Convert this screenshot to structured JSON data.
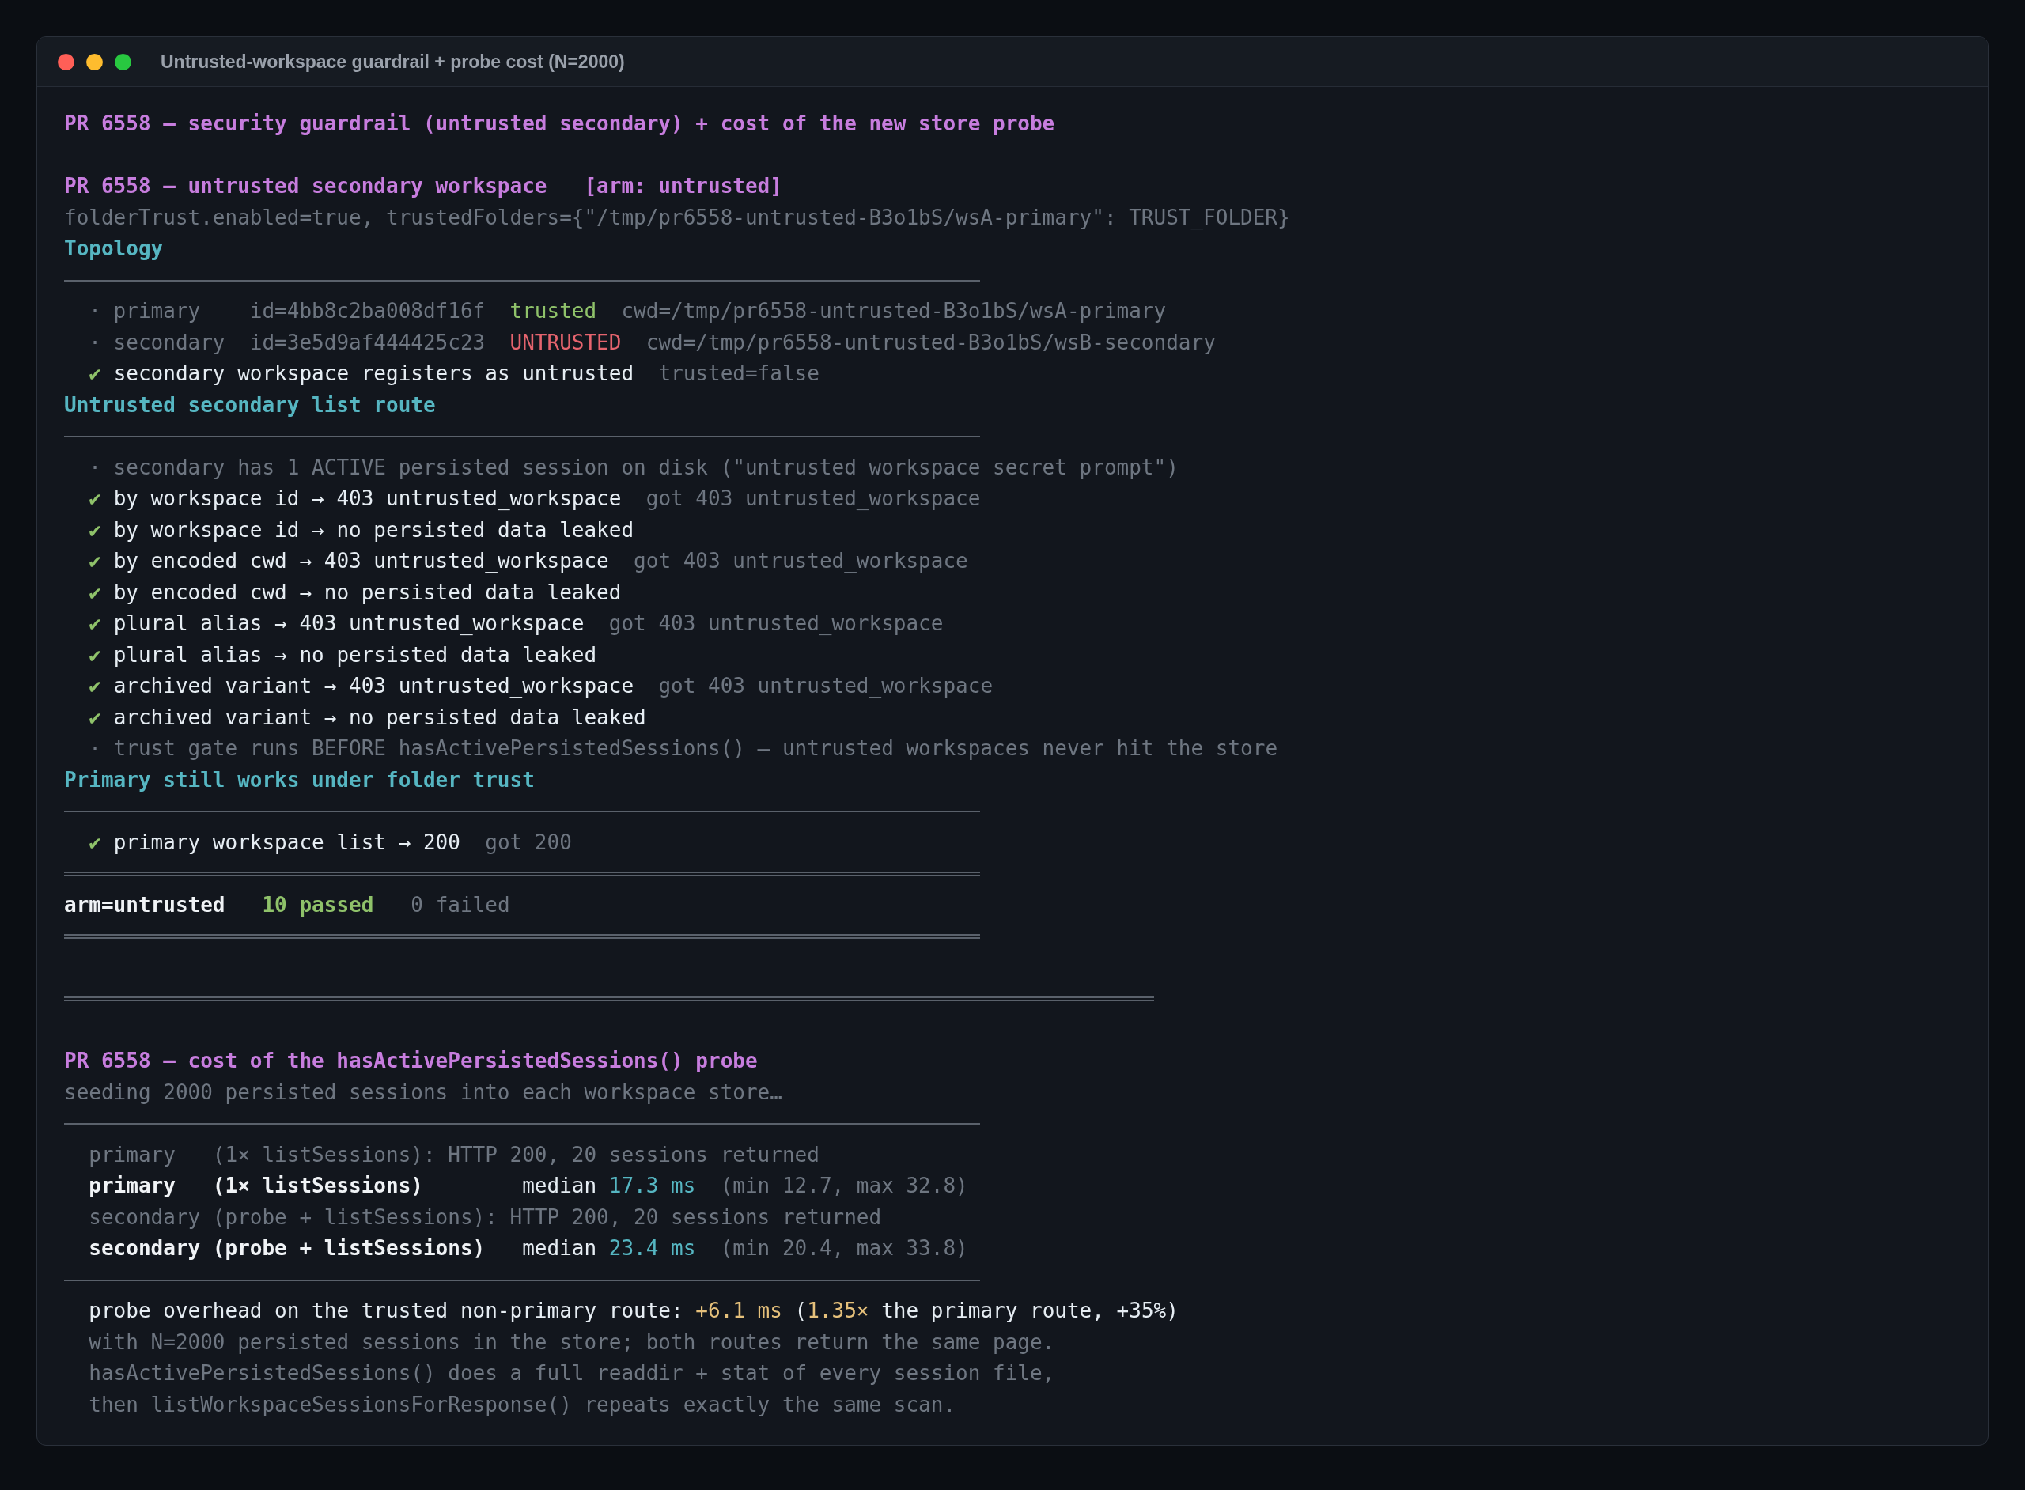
{
  "window": {
    "title": "Untrusted-workspace guardrail + probe cost (N=2000)"
  },
  "lines": [
    {
      "kind": "text",
      "segments": [
        {
          "kind": "heading",
          "text": "PR 6558 — security guardrail (untrusted secondary) + cost of the new store probe"
        }
      ]
    },
    {
      "kind": "blank"
    },
    {
      "kind": "text",
      "segments": [
        {
          "kind": "heading",
          "text": "PR 6558 — untrusted secondary workspace"
        },
        {
          "kind": "heading",
          "text": "   [arm: untrusted]"
        }
      ]
    },
    {
      "kind": "text",
      "segments": [
        {
          "kind": "dim",
          "text": "folderTrust.enabled=true, trustedFolders={\"/tmp/pr6558-untrusted-B3o1bS/wsA-primary\": TRUST_FOLDER}"
        }
      ]
    },
    {
      "kind": "text",
      "segments": [
        {
          "kind": "section",
          "text": "Topology"
        }
      ]
    },
    {
      "kind": "rule"
    },
    {
      "kind": "text",
      "segments": [
        {
          "kind": "dim",
          "text": "  · primary    id=4bb8c2ba008df16f"
        },
        {
          "kind": "ok",
          "text": "  trusted"
        },
        {
          "kind": "dim",
          "text": "  cwd=/tmp/pr6558-untrusted-B3o1bS/wsA-primary"
        }
      ]
    },
    {
      "kind": "text",
      "segments": [
        {
          "kind": "dim",
          "text": "  · secondary  id=3e5d9af444425c23"
        },
        {
          "kind": "fail",
          "text": "  UNTRUSTED"
        },
        {
          "kind": "dim",
          "text": "  cwd=/tmp/pr6558-untrusted-B3o1bS/wsB-secondary"
        }
      ]
    },
    {
      "kind": "text",
      "segments": [
        {
          "kind": "ok",
          "text": "  ✔"
        },
        {
          "kind": "text",
          "text": " secondary workspace registers as untrusted"
        },
        {
          "kind": "dim",
          "text": "  trusted=false"
        }
      ]
    },
    {
      "kind": "text",
      "segments": [
        {
          "kind": "section",
          "text": "Untrusted secondary list route"
        }
      ]
    },
    {
      "kind": "rule"
    },
    {
      "kind": "text",
      "segments": [
        {
          "kind": "dim",
          "text": "  · secondary has 1 ACTIVE persisted session on disk (\"untrusted workspace secret prompt\")"
        }
      ]
    },
    {
      "kind": "text",
      "segments": [
        {
          "kind": "ok",
          "text": "  ✔"
        },
        {
          "kind": "text",
          "text": " by workspace id → 403 untrusted_workspace"
        },
        {
          "kind": "dim",
          "text": "  got 403 untrusted_workspace"
        }
      ]
    },
    {
      "kind": "text",
      "segments": [
        {
          "kind": "ok",
          "text": "  ✔"
        },
        {
          "kind": "text",
          "text": " by workspace id → no persisted data leaked"
        }
      ]
    },
    {
      "kind": "text",
      "segments": [
        {
          "kind": "ok",
          "text": "  ✔"
        },
        {
          "kind": "text",
          "text": " by encoded cwd → 403 untrusted_workspace"
        },
        {
          "kind": "dim",
          "text": "  got 403 untrusted_workspace"
        }
      ]
    },
    {
      "kind": "text",
      "segments": [
        {
          "kind": "ok",
          "text": "  ✔"
        },
        {
          "kind": "text",
          "text": " by encoded cwd → no persisted data leaked"
        }
      ]
    },
    {
      "kind": "text",
      "segments": [
        {
          "kind": "ok",
          "text": "  ✔"
        },
        {
          "kind": "text",
          "text": " plural alias → 403 untrusted_workspace"
        },
        {
          "kind": "dim",
          "text": "  got 403 untrusted_workspace"
        }
      ]
    },
    {
      "kind": "text",
      "segments": [
        {
          "kind": "ok",
          "text": "  ✔"
        },
        {
          "kind": "text",
          "text": " plural alias → no persisted data leaked"
        }
      ]
    },
    {
      "kind": "text",
      "segments": [
        {
          "kind": "ok",
          "text": "  ✔"
        },
        {
          "kind": "text",
          "text": " archived variant → 403 untrusted_workspace"
        },
        {
          "kind": "dim",
          "text": "  got 403 untrusted_workspace"
        }
      ]
    },
    {
      "kind": "text",
      "segments": [
        {
          "kind": "ok",
          "text": "  ✔"
        },
        {
          "kind": "text",
          "text": " archived variant → no persisted data leaked"
        }
      ]
    },
    {
      "kind": "text",
      "segments": [
        {
          "kind": "dim",
          "text": "  · trust gate runs BEFORE hasActivePersistedSessions() — untrusted workspaces never hit the store"
        }
      ]
    },
    {
      "kind": "text",
      "segments": [
        {
          "kind": "section",
          "text": "Primary still works under folder trust"
        }
      ]
    },
    {
      "kind": "rule"
    },
    {
      "kind": "text",
      "segments": [
        {
          "kind": "ok",
          "text": "  ✔"
        },
        {
          "kind": "text",
          "text": " primary workspace list → 200"
        },
        {
          "kind": "dim",
          "text": "  got 200"
        }
      ]
    },
    {
      "kind": "double_rule"
    },
    {
      "kind": "text",
      "segments": [
        {
          "kind": "strong",
          "text": "arm=untrusted"
        },
        {
          "kind": "passed",
          "text": "   10 passed"
        },
        {
          "kind": "dim",
          "text": "   0 failed"
        }
      ]
    },
    {
      "kind": "double_rule"
    },
    {
      "kind": "blank"
    },
    {
      "kind": "long_double_rule"
    },
    {
      "kind": "blank"
    },
    {
      "kind": "text",
      "segments": [
        {
          "kind": "heading",
          "text": "PR 6558 — cost of the hasActivePersistedSessions() probe"
        }
      ]
    },
    {
      "kind": "text",
      "segments": [
        {
          "kind": "dim",
          "text": "seeding 2000 persisted sessions into each workspace store…"
        }
      ]
    },
    {
      "kind": "rule"
    },
    {
      "kind": "text",
      "segments": [
        {
          "kind": "dim",
          "text": "  primary   (1× listSessions): HTTP 200, 20 sessions returned"
        }
      ]
    },
    {
      "kind": "text",
      "segments": [
        {
          "kind": "strong",
          "text": "  primary   (1× listSessions)"
        },
        {
          "kind": "text",
          "text": "        median"
        },
        {
          "kind": "value",
          "text": " 17.3 ms"
        },
        {
          "kind": "dim",
          "text": "  (min 12.7, max 32.8)"
        }
      ]
    },
    {
      "kind": "text",
      "segments": [
        {
          "kind": "dim",
          "text": "  secondary (probe + listSessions): HTTP 200, 20 sessions returned"
        }
      ]
    },
    {
      "kind": "text",
      "segments": [
        {
          "kind": "strong",
          "text": "  secondary (probe + listSessions)"
        },
        {
          "kind": "text",
          "text": "   median"
        },
        {
          "kind": "value",
          "text": " 23.4 ms"
        },
        {
          "kind": "dim",
          "text": "  (min 20.4, max 33.8)"
        }
      ]
    },
    {
      "kind": "rule"
    },
    {
      "kind": "text",
      "segments": [
        {
          "kind": "text",
          "text": "  probe overhead on the trusted non-primary route:"
        },
        {
          "kind": "accent",
          "text": " +6.1 ms"
        },
        {
          "kind": "text",
          "text": " ("
        },
        {
          "kind": "accent",
          "text": "1.35×"
        },
        {
          "kind": "text",
          "text": " the primary route, +35%)"
        }
      ]
    },
    {
      "kind": "text",
      "segments": [
        {
          "kind": "dim",
          "text": "  with N=2000 persisted sessions in the store; both routes return the same page."
        }
      ]
    },
    {
      "kind": "text",
      "segments": [
        {
          "kind": "dim",
          "text": "  hasActivePersistedSessions() does a full readdir + stat of every session file,"
        }
      ]
    },
    {
      "kind": "text",
      "segments": [
        {
          "kind": "dim",
          "text": "  then listWorkspaceSessionsForResponse() repeats exactly the same scan."
        }
      ]
    }
  ]
}
